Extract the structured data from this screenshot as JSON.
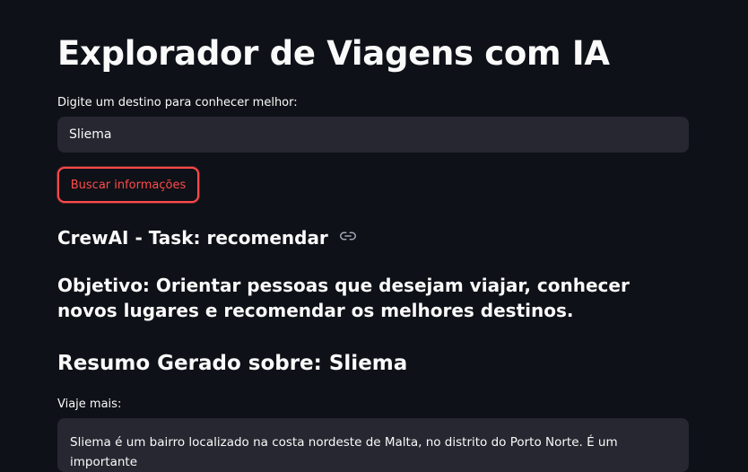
{
  "page": {
    "title": "Explorador de Viagens com IA"
  },
  "destination_input": {
    "label": "Digite um destino para conhecer melhor:",
    "value": "Sliema"
  },
  "search_button": {
    "label": "Buscar informações"
  },
  "crew": {
    "task_heading": "CrewAI - Task: recomendar",
    "objective": "Objetivo: Orientar pessoas que desejam viajar, conhecer novos lugares e recomendar os melhores destinos."
  },
  "summary": {
    "heading": "Resumo Gerado sobre: Sliema",
    "text_label": "Viaje mais:",
    "text": "Sliema é um bairro localizado na costa nordeste de Malta, no distrito do Porto Norte. É um importante"
  },
  "icons": {
    "task_link": "link-icon"
  },
  "colors": {
    "background": "#0e1117",
    "input_background": "#262730",
    "accent": "#ff4b4b",
    "text": "#fafafa"
  }
}
